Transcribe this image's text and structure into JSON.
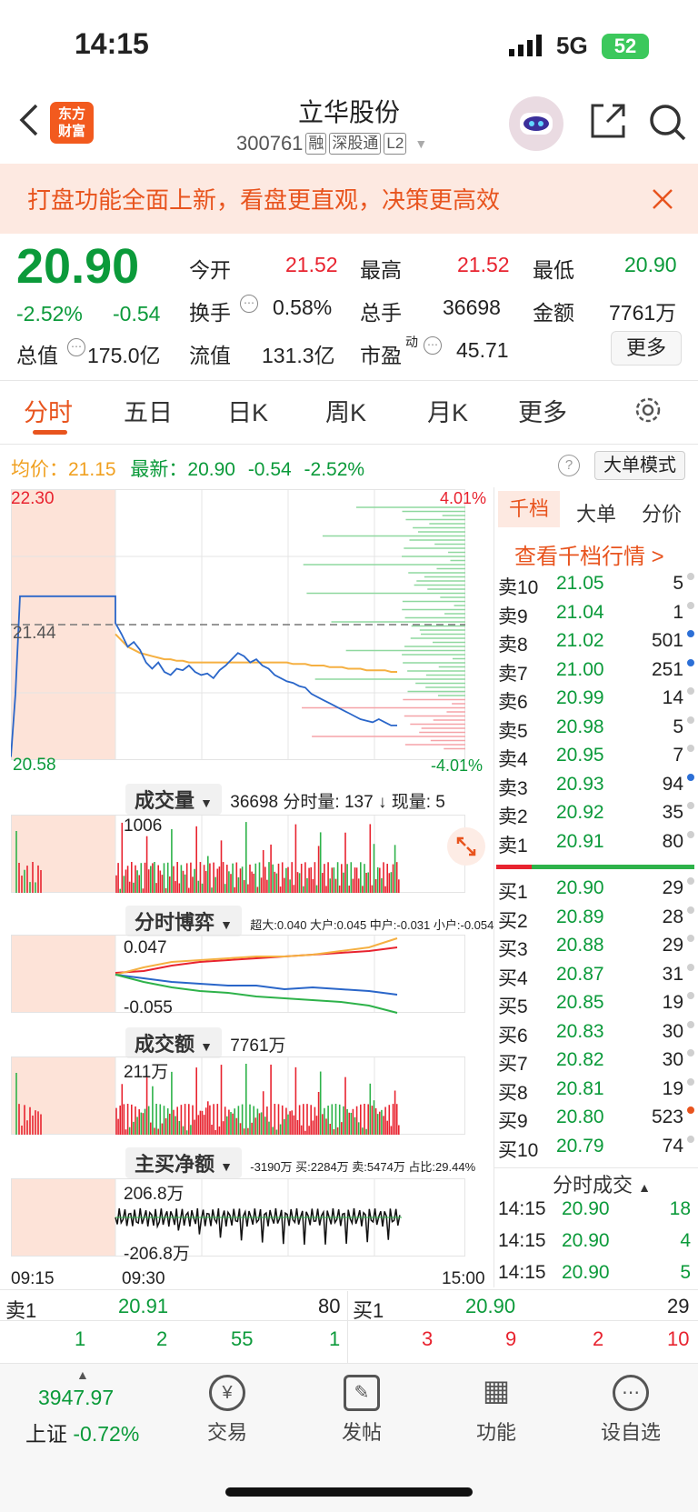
{
  "status": {
    "time": "14:15",
    "network": "5G",
    "battery": "52"
  },
  "header": {
    "name": "立华股份",
    "code": "300761",
    "tags": [
      "融",
      "深股通",
      "L2"
    ],
    "logo": "东方\n财富"
  },
  "banner": {
    "text": "打盘功能全面上新，看盘更直观，决策更高效"
  },
  "quote": {
    "price": "20.90",
    "change_pct": "-2.52%",
    "change": "-0.54",
    "open_label": "今开",
    "open": "21.52",
    "high_label": "最高",
    "high": "21.52",
    "low_label": "最低",
    "low": "20.90",
    "turnover_label": "换手",
    "turnover": "0.58%",
    "vol_label": "总手",
    "vol": "36698",
    "amount_label": "金额",
    "amount": "7761万",
    "mcap_label": "总值",
    "mcap": "175.0亿",
    "float_label": "流值",
    "float": "131.3亿",
    "pe_label": "市盈",
    "pe_sup": "动",
    "pe": "45.71",
    "more_button": "更多"
  },
  "tabs": [
    "分时",
    "五日",
    "日K",
    "周K",
    "月K",
    "更多"
  ],
  "chart_info": {
    "avg_label": "均价：",
    "avg": "21.15",
    "latest_label": "最新：",
    "latest": "20.90",
    "chg": "-0.54",
    "pct": "-2.52%",
    "bigorder_button": "大单模式"
  },
  "chart_data": {
    "type": "line",
    "y_top": "22.30",
    "y_bottom": "20.58",
    "y_mid": "21.44",
    "pct_top": "4.01%",
    "pct_bottom": "-4.01%",
    "x_labels": [
      "09:15",
      "09:30",
      "15:00"
    ],
    "prev_close": 21.44,
    "ylim": [
      20.58,
      22.3
    ],
    "price_series": [
      20.6,
      21.0,
      21.62,
      21.62,
      21.62,
      21.62,
      21.62,
      21.62,
      21.62,
      21.62,
      21.62,
      21.62,
      21.62,
      21.62,
      21.62,
      21.62,
      21.62,
      21.62,
      21.62,
      21.62,
      21.62,
      21.62,
      21.62,
      21.62,
      21.45,
      21.38,
      21.3,
      21.33,
      21.28,
      21.2,
      21.16,
      21.2,
      21.14,
      21.12,
      21.16,
      21.15,
      21.18,
      21.14,
      21.12,
      21.13,
      21.1,
      21.15,
      21.18,
      21.22,
      21.26,
      21.24,
      21.2,
      21.22,
      21.18,
      21.16,
      21.12,
      21.1,
      21.08,
      21.07,
      21.05,
      21.04,
      21.0,
      20.98,
      20.96,
      20.94,
      20.92,
      20.9,
      20.88,
      20.86,
      20.84,
      20.83,
      20.82,
      20.84,
      20.82,
      20.8,
      20.8
    ],
    "avg_series": [
      21.4,
      21.4,
      21.4,
      21.4,
      21.4,
      21.4,
      21.4,
      21.4,
      21.4,
      21.4,
      21.4,
      21.4,
      21.4,
      21.4,
      21.4,
      21.4,
      21.4,
      21.4,
      21.4,
      21.4,
      21.4,
      21.4,
      21.4,
      21.4,
      21.38,
      21.34,
      21.3,
      21.28,
      21.26,
      21.25,
      21.24,
      21.23,
      21.22,
      21.22,
      21.21,
      21.21,
      21.2,
      21.2,
      21.2,
      21.2,
      21.2,
      21.2,
      21.2,
      21.2,
      21.2,
      21.2,
      21.2,
      21.2,
      21.2,
      21.2,
      21.2,
      21.2,
      21.2,
      21.19,
      21.19,
      21.19,
      21.18,
      21.18,
      21.18,
      21.17,
      21.17,
      21.17,
      21.16,
      21.16,
      21.16,
      21.15,
      21.15,
      21.15,
      21.15,
      21.14,
      21.14
    ]
  },
  "volume": {
    "label": "成交量",
    "total": "36698",
    "sub": "分时量: 137 ↓ 现量: 5",
    "max": "1006"
  },
  "game": {
    "label": "分时博弈",
    "legend": "超大:0.040 大户:0.045 中户:-0.031 小户:-0.054",
    "top": "0.047",
    "bottom": "-0.055"
  },
  "amount": {
    "label": "成交额",
    "value": "7761万",
    "max": "211万"
  },
  "netbuy": {
    "label": "主买净额",
    "summary": "-3190万 买:2284万 卖:5474万 占比:29.44%",
    "top": "206.8万",
    "bottom": "-206.8万"
  },
  "orderbook": {
    "tabs": [
      "千档",
      "大单",
      "分价"
    ],
    "link": "查看千档行情 >",
    "asks": [
      {
        "l": "卖10",
        "p": "21.05",
        "v": "5",
        "c": "#cfcfcf"
      },
      {
        "l": "卖9",
        "p": "21.04",
        "v": "1",
        "c": "#cfcfcf"
      },
      {
        "l": "卖8",
        "p": "21.02",
        "v": "501",
        "c": "#2c6fd6"
      },
      {
        "l": "卖7",
        "p": "21.00",
        "v": "251",
        "c": "#2c6fd6"
      },
      {
        "l": "卖6",
        "p": "20.99",
        "v": "14",
        "c": "#cfcfcf"
      },
      {
        "l": "卖5",
        "p": "20.98",
        "v": "5",
        "c": "#cfcfcf"
      },
      {
        "l": "卖4",
        "p": "20.95",
        "v": "7",
        "c": "#cfcfcf"
      },
      {
        "l": "卖3",
        "p": "20.93",
        "v": "94",
        "c": "#2c6fd6"
      },
      {
        "l": "卖2",
        "p": "20.92",
        "v": "35",
        "c": "#cfcfcf"
      },
      {
        "l": "卖1",
        "p": "20.91",
        "v": "80",
        "c": "#cfcfcf"
      }
    ],
    "bids": [
      {
        "l": "买1",
        "p": "20.90",
        "v": "29",
        "c": "#cfcfcf"
      },
      {
        "l": "买2",
        "p": "20.89",
        "v": "28",
        "c": "#cfcfcf"
      },
      {
        "l": "买3",
        "p": "20.88",
        "v": "29",
        "c": "#cfcfcf"
      },
      {
        "l": "买4",
        "p": "20.87",
        "v": "31",
        "c": "#cfcfcf"
      },
      {
        "l": "买5",
        "p": "20.85",
        "v": "19",
        "c": "#cfcfcf"
      },
      {
        "l": "买6",
        "p": "20.83",
        "v": "30",
        "c": "#cfcfcf"
      },
      {
        "l": "买7",
        "p": "20.82",
        "v": "30",
        "c": "#cfcfcf"
      },
      {
        "l": "买8",
        "p": "20.81",
        "v": "19",
        "c": "#cfcfcf"
      },
      {
        "l": "买9",
        "p": "20.80",
        "v": "523",
        "c": "#e8541e"
      },
      {
        "l": "买10",
        "p": "20.79",
        "v": "74",
        "c": "#cfcfcf"
      }
    ],
    "trades_label": "分时成交",
    "trades": [
      {
        "t": "14:15",
        "p": "20.90",
        "v": "18"
      },
      {
        "t": "14:15",
        "p": "20.90",
        "v": "4"
      },
      {
        "t": "14:15",
        "p": "20.90",
        "v": "5"
      }
    ]
  },
  "level1": {
    "ask_label": "卖1",
    "ask_price": "20.91",
    "ask_vol": "80",
    "bid_label": "买1",
    "bid_price": "20.90",
    "bid_vol": "29",
    "ask_counts": [
      "1",
      "2",
      "55",
      "1"
    ],
    "bid_counts": [
      "3",
      "9",
      "2",
      "10"
    ]
  },
  "bottom_nav": {
    "index_value": "3947.97",
    "index_name": "上证",
    "index_pct": "-0.72%",
    "items": [
      {
        "label": "交易",
        "icon": "¥"
      },
      {
        "label": "发帖",
        "icon": "✎"
      },
      {
        "label": "功能",
        "icon": "▦"
      },
      {
        "label": "设自选",
        "icon": "⋯"
      }
    ]
  }
}
